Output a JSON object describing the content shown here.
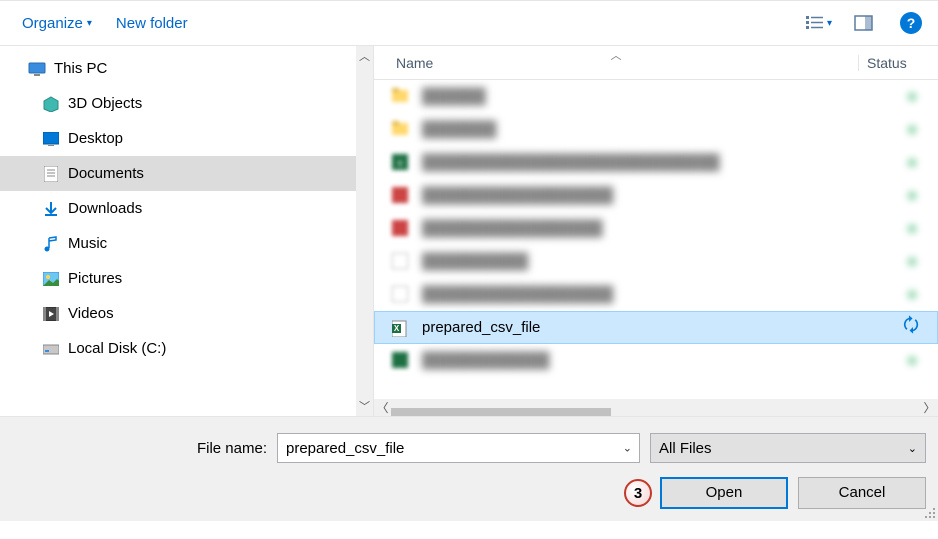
{
  "toolbar": {
    "organize": "Organize",
    "newfolder": "New folder"
  },
  "nav": {
    "root": "This PC",
    "items": [
      {
        "label": "3D Objects"
      },
      {
        "label": "Desktop"
      },
      {
        "label": "Documents"
      },
      {
        "label": "Downloads"
      },
      {
        "label": "Music"
      },
      {
        "label": "Pictures"
      },
      {
        "label": "Videos"
      },
      {
        "label": "Local Disk (C:)"
      }
    ]
  },
  "columns": {
    "name": "Name",
    "status": "Status"
  },
  "files": {
    "selected": "prepared_csv_file"
  },
  "footer": {
    "filename_label": "File name:",
    "filename_value": "prepared_csv_file",
    "filetype": "All Files",
    "step_number": "3",
    "open": "Open",
    "cancel": "Cancel"
  }
}
